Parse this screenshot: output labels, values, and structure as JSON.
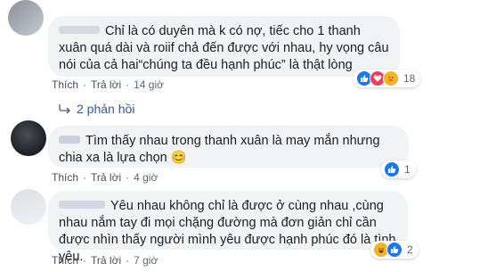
{
  "comments": [
    {
      "text": "Chỉ là có duyên mà k có nợ, tiếc cho 1 thanh xuân quá dài và roiif chả đến được với nhau, hy vọng câu nói của cả hai“chúng ta đều hạnh phúc” là thật lòng",
      "like": "Thích",
      "reply": "Trả lời",
      "time": "14 giờ",
      "reaction_count": "18",
      "reactions": [
        "like-icon",
        "love-icon",
        "sad-icon"
      ]
    },
    {
      "text": "Tìm thấy nhau trong thanh xuân là may mắn nhưng chia xa là lựa chọn 😊",
      "like": "Thích",
      "reply": "Trả lời",
      "time": "4 giờ",
      "reaction_count": "1",
      "reactions": [
        "like-icon"
      ]
    },
    {
      "text": "Yêu nhau không chỉ là được ở cùng nhau ,cùng nhau nắm tay đi mọi chặng đường mà đơn giản chỉ cần được nhìn thấy người mình yêu được hạnh phúc đó là tình yêu.",
      "like": "Thích",
      "reply": "Trả lời",
      "time": "7 giờ",
      "reaction_count": "2",
      "reactions": [
        "haha-icon",
        "like-icon"
      ]
    }
  ],
  "replies_link": "2 phản hồi",
  "colors": {
    "bubble": "#f2f3f5",
    "link_blue": "#385898",
    "like_blue": "#1877f2",
    "love_red": "#f33e58",
    "sad_yellow": "#f7b125"
  }
}
